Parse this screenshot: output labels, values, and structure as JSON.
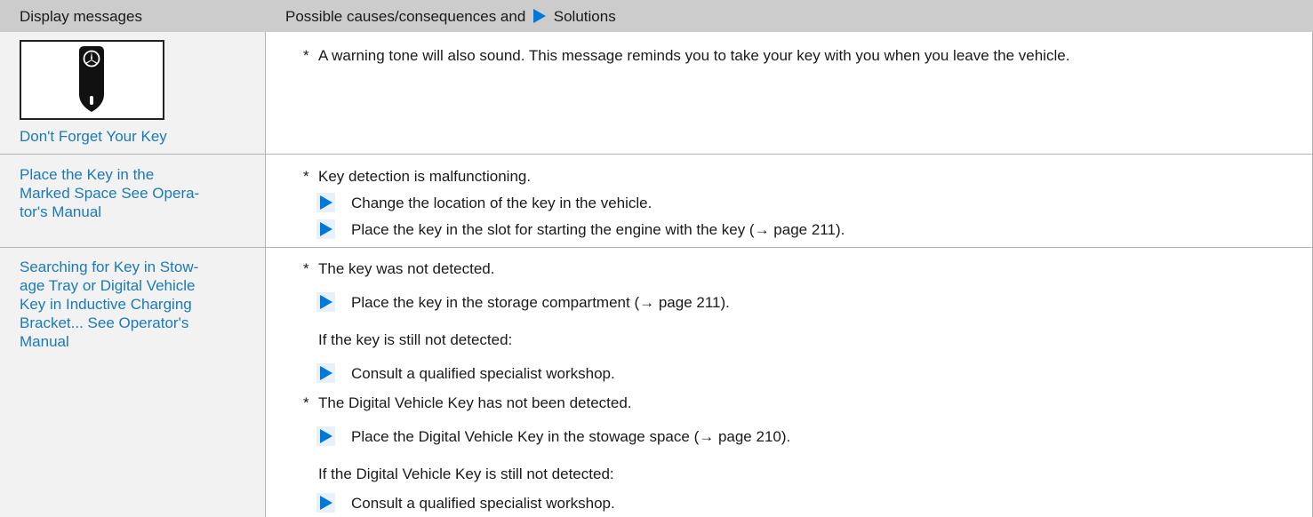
{
  "header": {
    "col1": "Display messages",
    "col2_pre": "Possible causes/consequences and",
    "col2_post": "Solutions"
  },
  "rows": [
    {
      "message": "Don't Forget Your Key",
      "icon": "key-icon",
      "items": [
        {
          "type": "bullet",
          "text": "A warning tone will also sound. This message reminds you to take your key with you when you leave the vehicle."
        }
      ]
    },
    {
      "message": "Place the Key in the Marked Space See Operator's Manual",
      "message_lines": [
        "Place the Key in the",
        "Marked Space See Opera-",
        "tor's Manual"
      ],
      "items": [
        {
          "type": "bullet",
          "text": "Key detection is malfunctioning."
        },
        {
          "type": "action",
          "text": "Change the location of the key in the vehicle."
        },
        {
          "type": "action",
          "text": "Place the key in the slot for starting the engine with the key (→ page 211)."
        }
      ]
    },
    {
      "message": "Searching for Key in Stowage Tray or Digital Vehicle Key in Inductive Charging Bracket... See Operator's Manual",
      "message_lines": [
        "Searching for Key in Stow-",
        "age Tray or Digital Vehicle",
        "Key in Inductive Charging",
        "Bracket... See Operator's",
        "Manual"
      ],
      "items": [
        {
          "type": "bullet",
          "text": "The key was not detected."
        },
        {
          "type": "action",
          "text": "Place the key in the storage compartment (→ page 211)."
        },
        {
          "type": "plain",
          "text": "If the key is still not detected:"
        },
        {
          "type": "action",
          "text": "Consult a qualified specialist workshop."
        },
        {
          "type": "bullet",
          "text": "The Digital Vehicle Key has not been detected."
        },
        {
          "type": "action",
          "text": "Place the Digital Vehicle Key in the stowage space (→ page 210)."
        },
        {
          "type": "plain",
          "text": "If the Digital Vehicle Key is still not detected:"
        },
        {
          "type": "action",
          "text": "Consult a qualified specialist workshop."
        }
      ]
    }
  ],
  "bullet_char": "*",
  "colors": {
    "header_bg": "#cccccc",
    "left_col_bg": "#f2f2f2",
    "message_text": "#1a7ab8",
    "arrow": "#0078d7"
  }
}
